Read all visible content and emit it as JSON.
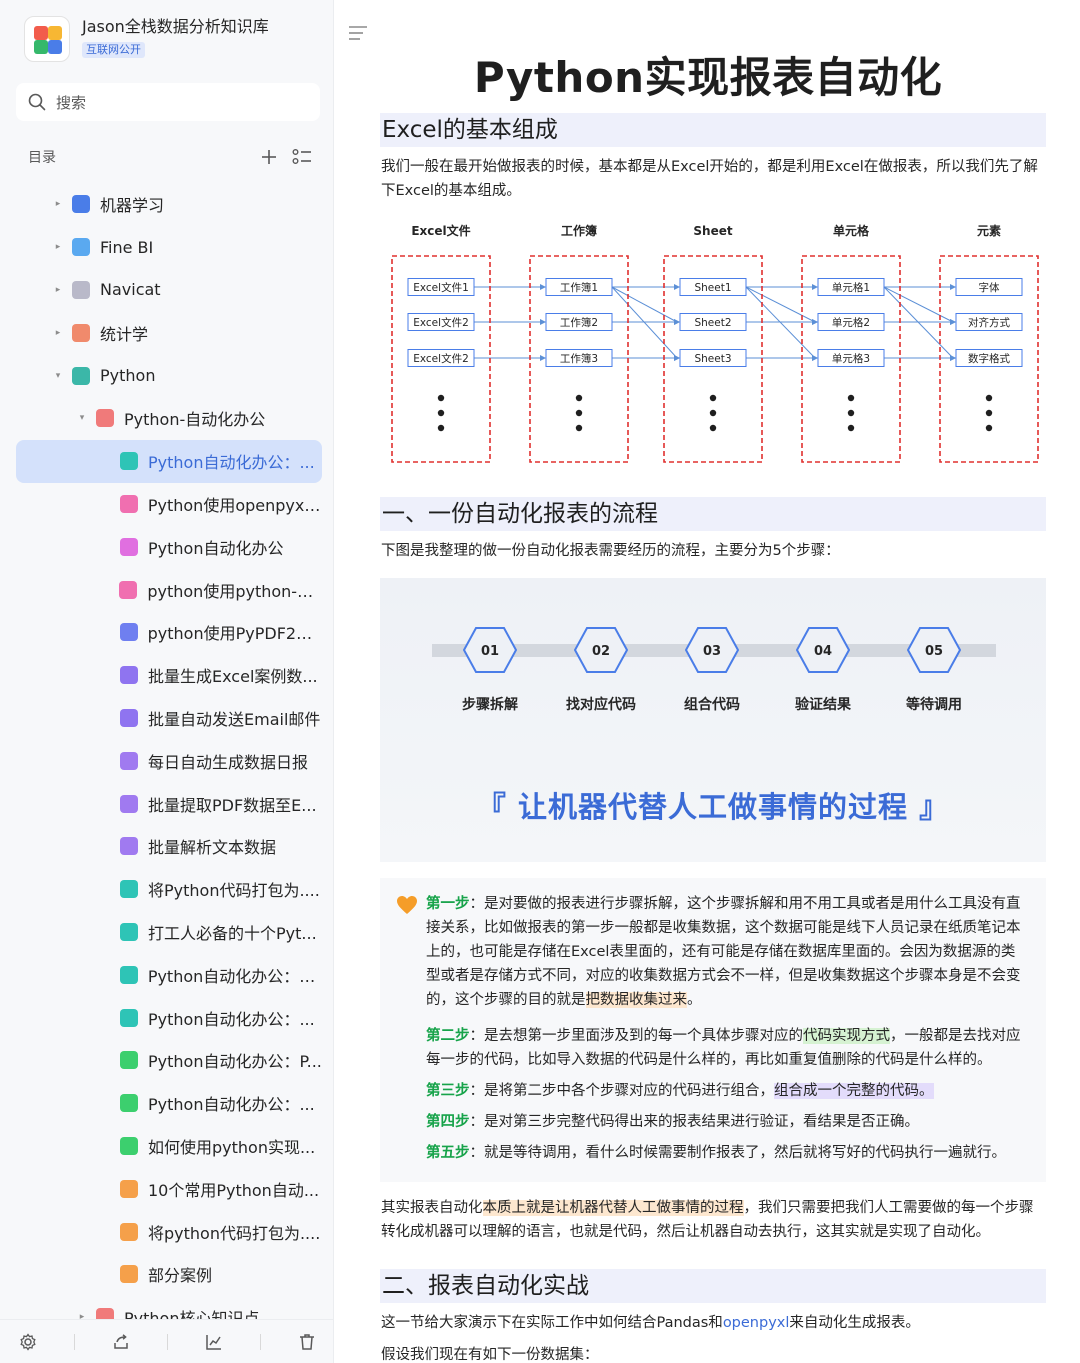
{
  "app": {
    "title": "Jason全栈数据分析知识库",
    "badge": "互联网公开",
    "search_placeholder": "搜索",
    "toc_label": "目录"
  },
  "tree": [
    {
      "label": "机器学习",
      "icon": "ml-icon",
      "color": "#4a7de8",
      "caret": "▸",
      "indent": 0
    },
    {
      "label": "Fine BI",
      "icon": "globe-icon",
      "color": "#5aa9f0",
      "caret": "▸",
      "indent": 0
    },
    {
      "label": "Navicat",
      "icon": "gear-icon",
      "color": "#b9b9c9",
      "caret": "▸",
      "indent": 0
    },
    {
      "label": "统计学",
      "icon": "pen-icon",
      "color": "#f08a6c",
      "caret": "▸",
      "indent": 0
    },
    {
      "label": "Python",
      "icon": "python-icon",
      "color": "#3bb7a8",
      "caret": "▾",
      "indent": 0
    },
    {
      "label": "Python-自动化办公",
      "icon": "folder-icon",
      "color": "#f07a7a",
      "caret": "▾",
      "indent": 1
    },
    {
      "label": "Python自动化办公：...",
      "icon": "doc-icon",
      "color": "#2ec4b6",
      "caret": "",
      "indent": 2,
      "active": true
    },
    {
      "label": "Python使用openpyxl...",
      "icon": "doc-icon",
      "color": "#f06fb0",
      "caret": "",
      "indent": 2
    },
    {
      "label": "Python自动化办公",
      "icon": "doc-icon",
      "color": "#e06fe0",
      "caret": "",
      "indent": 2
    },
    {
      "label": "python使用python-do...",
      "icon": "doc-icon",
      "color": "#f06fb0",
      "caret": "",
      "indent": 2
    },
    {
      "label": "python使用PyPDF2和...",
      "icon": "doc-icon",
      "color": "#6f7ff0",
      "caret": "",
      "indent": 2
    },
    {
      "label": "批量生成Excel案例数...",
      "icon": "doc-icon",
      "color": "#8f74f0",
      "caret": "",
      "indent": 2
    },
    {
      "label": "批量自动发送Email邮件",
      "icon": "doc-icon",
      "color": "#8f74f0",
      "caret": "",
      "indent": 2
    },
    {
      "label": "每日自动生成数据日报",
      "icon": "doc-icon",
      "color": "#a07af0",
      "caret": "",
      "indent": 2
    },
    {
      "label": "批量提取PDF数据至E...",
      "icon": "doc-icon",
      "color": "#a07af0",
      "caret": "",
      "indent": 2
    },
    {
      "label": "批量解析文本数据",
      "icon": "doc-icon",
      "color": "#a07af0",
      "caret": "",
      "indent": 2
    },
    {
      "label": "将Python代码打包为....",
      "icon": "doc-icon",
      "color": "#2ec4b6",
      "caret": "",
      "indent": 2
    },
    {
      "label": "打工人必备的十个Pyt...",
      "icon": "doc-icon",
      "color": "#2ec4b6",
      "caret": "",
      "indent": 2
    },
    {
      "label": "Python自动化办公：E...",
      "icon": "doc-icon",
      "color": "#2ec4b6",
      "caret": "",
      "indent": 2
    },
    {
      "label": "Python自动化办公：...",
      "icon": "doc-icon",
      "color": "#2ec4b6",
      "caret": "",
      "indent": 2
    },
    {
      "label": "Python自动化办公：P...",
      "icon": "doc-icon",
      "color": "#3ccf6e",
      "caret": "",
      "indent": 2
    },
    {
      "label": "Python自动化办公：...",
      "icon": "doc-icon",
      "color": "#3ccf6e",
      "caret": "",
      "indent": 2
    },
    {
      "label": "如何使用python实现...",
      "icon": "doc-icon",
      "color": "#3ccf6e",
      "caret": "",
      "indent": 2
    },
    {
      "label": "10个常用Python自动...",
      "icon": "doc-icon",
      "color": "#f5a04a",
      "caret": "",
      "indent": 2
    },
    {
      "label": "将python代码打包为....",
      "icon": "doc-icon",
      "color": "#f5a04a",
      "caret": "",
      "indent": 2
    },
    {
      "label": "部分案例",
      "icon": "doc-icon",
      "color": "#f5a04a",
      "caret": "",
      "indent": 2
    },
    {
      "label": "Python核心知识点",
      "icon": "folder-icon",
      "color": "#f07a7a",
      "caret": "▸",
      "indent": 1
    }
  ],
  "doc": {
    "title": "Python实现报表自动化",
    "h_excel": "Excel的基本组成",
    "p_excel": "我们一般在最开始做报表的时候，基本都是从Excel开始的，都是利用Excel在做报表，所以我们先了解下Excel的基本组成。",
    "diagram": {
      "columns": [
        {
          "header": "Excel文件",
          "items": [
            "Excel文件1",
            "Excel文件2",
            "Excel文件2"
          ]
        },
        {
          "header": "工作簿",
          "items": [
            "工作簿1",
            "工作簿2",
            "工作簿3"
          ]
        },
        {
          "header": "Sheet",
          "items": [
            "Sheet1",
            "Sheet2",
            "Sheet3"
          ]
        },
        {
          "header": "单元格",
          "items": [
            "单元格1",
            "单元格2",
            "单元格3"
          ]
        },
        {
          "header": "元素",
          "items": [
            "字体",
            "对齐方式",
            "数字格式"
          ]
        }
      ]
    },
    "h_flow": "一、一份自动化报表的流程",
    "p_flow": "下图是我整理的做一份自动化报表需要经历的流程，主要分为5个步骤：",
    "steps": [
      {
        "num": "01",
        "label": "步骤拆解"
      },
      {
        "num": "02",
        "label": "找对应代码"
      },
      {
        "num": "03",
        "label": "组合代码"
      },
      {
        "num": "04",
        "label": "验证结果"
      },
      {
        "num": "05",
        "label": "等待调用"
      }
    ],
    "slogan": "『 让机器代替人工做事情的过程 』",
    "callout": {
      "s1_tag": "第一步",
      "s1_a": "：是对要做的报表进行步骤拆解，这个步骤拆解和用不用工具或者是用什么工具没有直接关系，比如做报表的第一步一般都是收集数据，这个数据可能是线下人员记录在纸质笔记本上的，也可能是存储在Excel表里面的，还有可能是存储在数据库里面的。会因为数据源的类型或者是存储方式不同，对应的收集数据方式会不一样，但是收集数据这个步骤本身是不会变的，这个步骤的目的就是",
      "s1_hl": "把数据收集过来",
      "s1_end": "。",
      "s2_tag": "第二步",
      "s2_a": "：是去想第一步里面涉及到的每一个具体步骤对应的",
      "s2_hl": "代码实现方式",
      "s2_b": "，一般都是去找对应每一步的代码，比如导入数据的代码是什么样的，再比如重复值删除的代码是什么样的。",
      "s3_tag": "第三步",
      "s3_a": "：是将第二步中各个步骤对应的代码进行组合，",
      "s3_hl": "组合成一个完整的代码。",
      "s4_tag": "第四步",
      "s4_a": "：是对第三步完整代码得出来的报表结果进行验证，看结果是否正确。",
      "s5_tag": "第五步",
      "s5_a": "：就是等待调用，看什么时候需要制作报表了，然后就将写好的代码执行一遍就行。"
    },
    "p_summary_a": "其实报表自动化",
    "p_summary_hl": "本质上就是让机器代替人工做事情的过程",
    "p_summary_b": "，我们只需要把我们人工需要做的每一个步骤转化成机器可以理解的语言，也就是代码，然后让机器自动去执行，这其实就是实现了自动化。",
    "h_practice": "二、报表自动化实战",
    "p_practice_a": "这一节给大家演示下在实际工作中如何结合Pandas和",
    "p_practice_link": "openpyxl",
    "p_practice_b": "来自动化生成报表。",
    "p_dataset": "假设我们现在有如下一份数据集："
  }
}
